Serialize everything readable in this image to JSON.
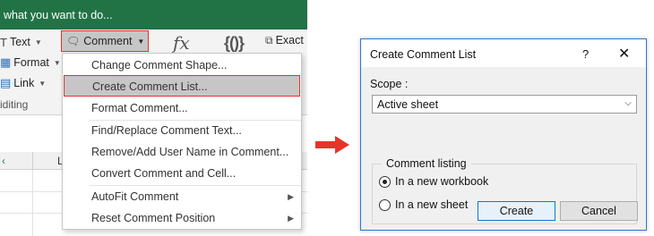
{
  "excel": {
    "tell_me_text": "what you want to do...",
    "ribbon": {
      "text_label": "Text",
      "format_label": "Format",
      "link_label": "Link",
      "comment_label": "Comment",
      "fx_symbol": "fx",
      "brace_symbol": "{()}",
      "exact_label": "Exact",
      "group_label": "iditing"
    },
    "grid": {
      "column_letter": "L"
    },
    "menu_items": [
      {
        "label": "Change Comment Shape...",
        "submenu": false,
        "highlighted": false
      },
      {
        "label": "Create Comment List...",
        "submenu": false,
        "highlighted": true
      },
      {
        "label": "Format Comment...",
        "submenu": false,
        "highlighted": false
      },
      {
        "label": "Find/Replace Comment Text...",
        "submenu": false,
        "highlighted": false
      },
      {
        "label": "Remove/Add User Name in Comment...",
        "submenu": false,
        "highlighted": false
      },
      {
        "label": "Convert Comment and Cell...",
        "submenu": false,
        "highlighted": false
      },
      {
        "label": "AutoFit Comment",
        "submenu": true,
        "highlighted": false
      },
      {
        "label": "Reset Comment Position",
        "submenu": true,
        "highlighted": false
      }
    ]
  },
  "dialog": {
    "title": "Create Comment List",
    "help_symbol": "?",
    "close_symbol": "✕",
    "scope_label": "Scope :",
    "scope_value": "Active sheet",
    "listing_label": "Comment listing",
    "option_new_workbook": "In a new workbook",
    "option_new_sheet": "In a new sheet",
    "selected_option": "In a new workbook",
    "create_label": "Create",
    "cancel_label": "Cancel"
  },
  "colors": {
    "excel_green": "#217346",
    "highlight_red": "#e0322b",
    "arrow_red": "#e8332a",
    "dialog_border": "#2b79d6"
  }
}
